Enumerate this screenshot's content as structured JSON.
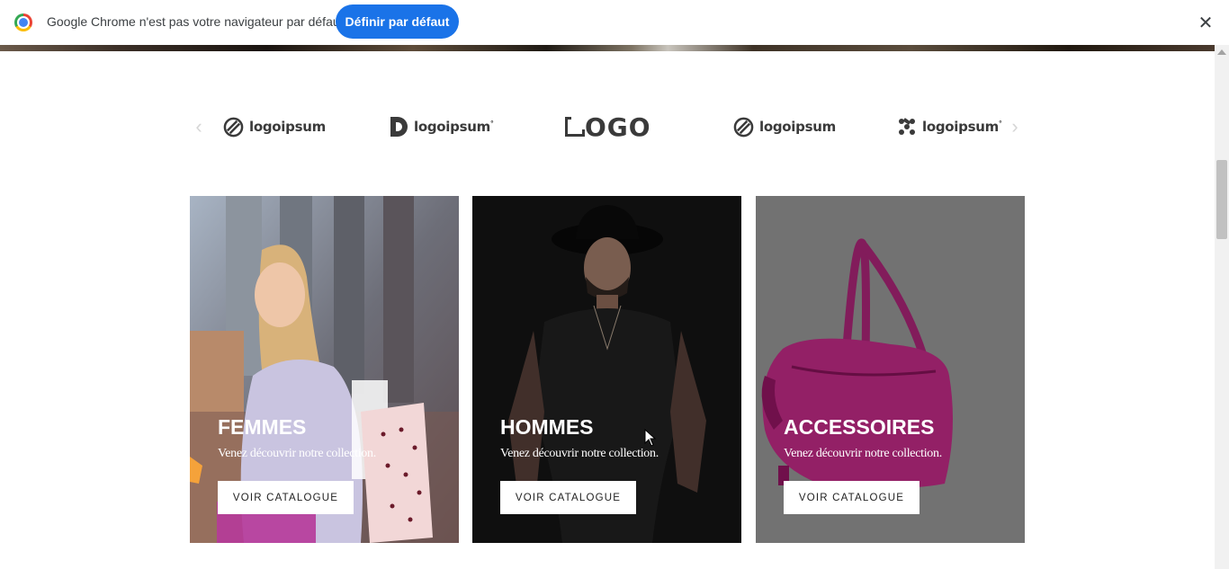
{
  "infobar": {
    "message": "Google Chrome n'est pas votre navigateur par défaut",
    "button_label": "Définir par défaut",
    "close_icon": "close-icon",
    "logo_icon": "chrome-logo-icon"
  },
  "logos": {
    "prev_icon": "chevron-left-icon",
    "next_icon": "chevron-right-icon",
    "items": [
      {
        "text": "logoipsum"
      },
      {
        "text": "logoipsum"
      },
      {
        "text": "OGO"
      },
      {
        "text": "logoipsum"
      },
      {
        "text": "logoipsum"
      }
    ]
  },
  "categories": [
    {
      "title": "FEMMES",
      "subtitle": "Venez découvrir notre collection.",
      "button": "VOIR CATALOGUE"
    },
    {
      "title": "HOMMES",
      "subtitle": "Venez découvrir notre collection.",
      "button": "VOIR CATALOGUE"
    },
    {
      "title": "ACCESSOIRES",
      "subtitle": "Venez découvrir notre collection.",
      "button": "VOIR CATALOGUE"
    }
  ],
  "colors": {
    "chrome_button": "#1a73e8",
    "bag": "#a0236f"
  }
}
